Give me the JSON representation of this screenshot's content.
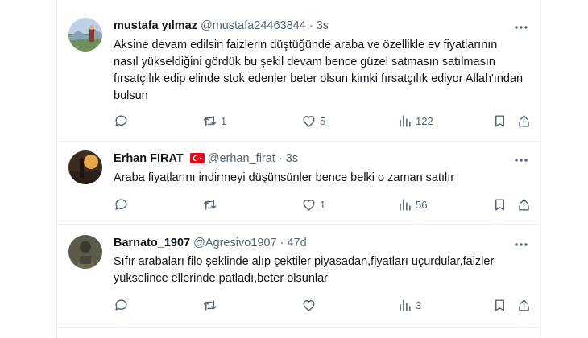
{
  "tweets": [
    {
      "name": "mustafa yılmaz",
      "handle": "@mustafa24463844",
      "dot": "·",
      "time": "3s",
      "text": "Aksine devam edilsin faizlerin düştüğünde araba ve özellikle ev fiyatlarının nasıl yükseldiğini gördük bu şekil devam bence güzel satmasın satılmasın fırsatçılık edip elinde stok edenler beter olsun kimki fırsatçılık ediyor Allah'ından bulsun",
      "retweets": "1",
      "likes": "5",
      "views": "122"
    },
    {
      "name": "Erhan FIRAT",
      "handle": "@erhan_firat",
      "dot": "·",
      "time": "3s",
      "text": "Araba fiyatlarını indirmeyi düşünsünler bence belki o zaman satılır",
      "retweets": "",
      "likes": "1",
      "views": "56"
    },
    {
      "name": "Barnato_1907",
      "handle": "@Agresivo1907",
      "dot": "·",
      "time": "47d",
      "text": "Sıfır arabaları filo şeklinde alıp çektiler piyasadan,fiyatları uçurdular,faizler yükselince ellerinde patladı,beter olsunlar",
      "retweets": "",
      "likes": "",
      "views": "3"
    }
  ],
  "icons": {
    "reply": "reply-icon",
    "retweet": "retweet-icon",
    "like": "heart-icon",
    "views": "views-icon",
    "bookmark": "bookmark-icon",
    "share": "share-icon",
    "more": "more-icon",
    "flag": "turkey-flag-icon"
  },
  "colors": {
    "text": "#0f1419",
    "secondary": "#536471",
    "border": "#eff3f4",
    "flag": "#e30a17"
  }
}
